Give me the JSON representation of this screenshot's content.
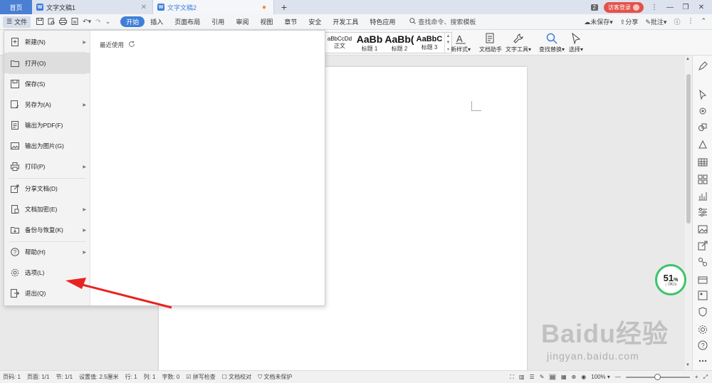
{
  "titlebar": {
    "home_tab": "首页",
    "tabs": [
      {
        "label": "文字文稿1",
        "icon": "writer-doc-icon"
      },
      {
        "label": "文字文稿2",
        "icon": "writer-doc-icon"
      }
    ],
    "window_count": "2",
    "visitor_login": "访客登录"
  },
  "menubar": {
    "file_label": "文件",
    "items": [
      "开始",
      "插入",
      "页面布局",
      "引用",
      "审阅",
      "视图",
      "章节",
      "安全",
      "开发工具",
      "特色应用"
    ],
    "active_index": 0,
    "search_placeholder": "查找命令、搜索模板",
    "unsaved": "未保存",
    "share": "分享",
    "comment": "批注"
  },
  "ribbon": {
    "styles": [
      {
        "preview": "aBbCcDd",
        "name": "正文"
      },
      {
        "preview": "AaBb",
        "name": "标题 1"
      },
      {
        "preview": "AaBb(",
        "name": "标题 2"
      },
      {
        "preview": "AaBbC",
        "name": "标题 3"
      }
    ],
    "new_style": "新样式",
    "doc_assistant": "文档助手",
    "text_tools": "文字工具",
    "find_replace": "查找替换",
    "select": "选择"
  },
  "file_menu": {
    "items": [
      {
        "label": "新建(N)",
        "icon": "new-doc-icon",
        "submenu": true
      },
      {
        "label": "打开(O)",
        "icon": "folder-open-icon",
        "submenu": false
      },
      {
        "label": "保存(S)",
        "icon": "save-icon",
        "submenu": false
      },
      {
        "label": "另存为(A)",
        "icon": "save-as-icon",
        "submenu": true
      },
      {
        "label": "输出为PDF(F)",
        "icon": "export-pdf-icon",
        "submenu": false
      },
      {
        "label": "输出为图片(G)",
        "icon": "export-image-icon",
        "submenu": false
      },
      {
        "label": "打印(P)",
        "icon": "printer-icon",
        "submenu": true
      },
      {
        "label": "分享文档(D)",
        "icon": "share-icon",
        "submenu": false
      },
      {
        "label": "文档加密(E)",
        "icon": "lock-doc-icon",
        "submenu": true
      },
      {
        "label": "备份与恢复(K)",
        "icon": "backup-icon",
        "submenu": true
      },
      {
        "label": "帮助(H)",
        "icon": "help-icon",
        "submenu": true
      },
      {
        "label": "选项(L)",
        "icon": "gear-icon",
        "submenu": false
      },
      {
        "label": "退出(Q)",
        "icon": "exit-icon",
        "submenu": false
      }
    ],
    "hovered_index": 1,
    "recent_label": "最近使用"
  },
  "speed_widget": {
    "percent": "51",
    "unit": "%",
    "rate": "0K/s"
  },
  "statusbar": {
    "items": [
      "页码: 1",
      "页面: 1/1",
      "节: 1/1",
      "设置值: 2.5厘米",
      "行: 1",
      "列: 1",
      "字数: 0"
    ],
    "spell_check": "拼写检查",
    "proofread": "文档校对",
    "protect": "文档未保护",
    "zoom": "100%"
  },
  "watermark": {
    "line1": "Baidu经验",
    "line2": "jingyan.baidu.com"
  },
  "colors": {
    "accent": "#3f7fd8",
    "annotation_arrow": "#e8231f",
    "speed_ring": "#3cc46b"
  }
}
